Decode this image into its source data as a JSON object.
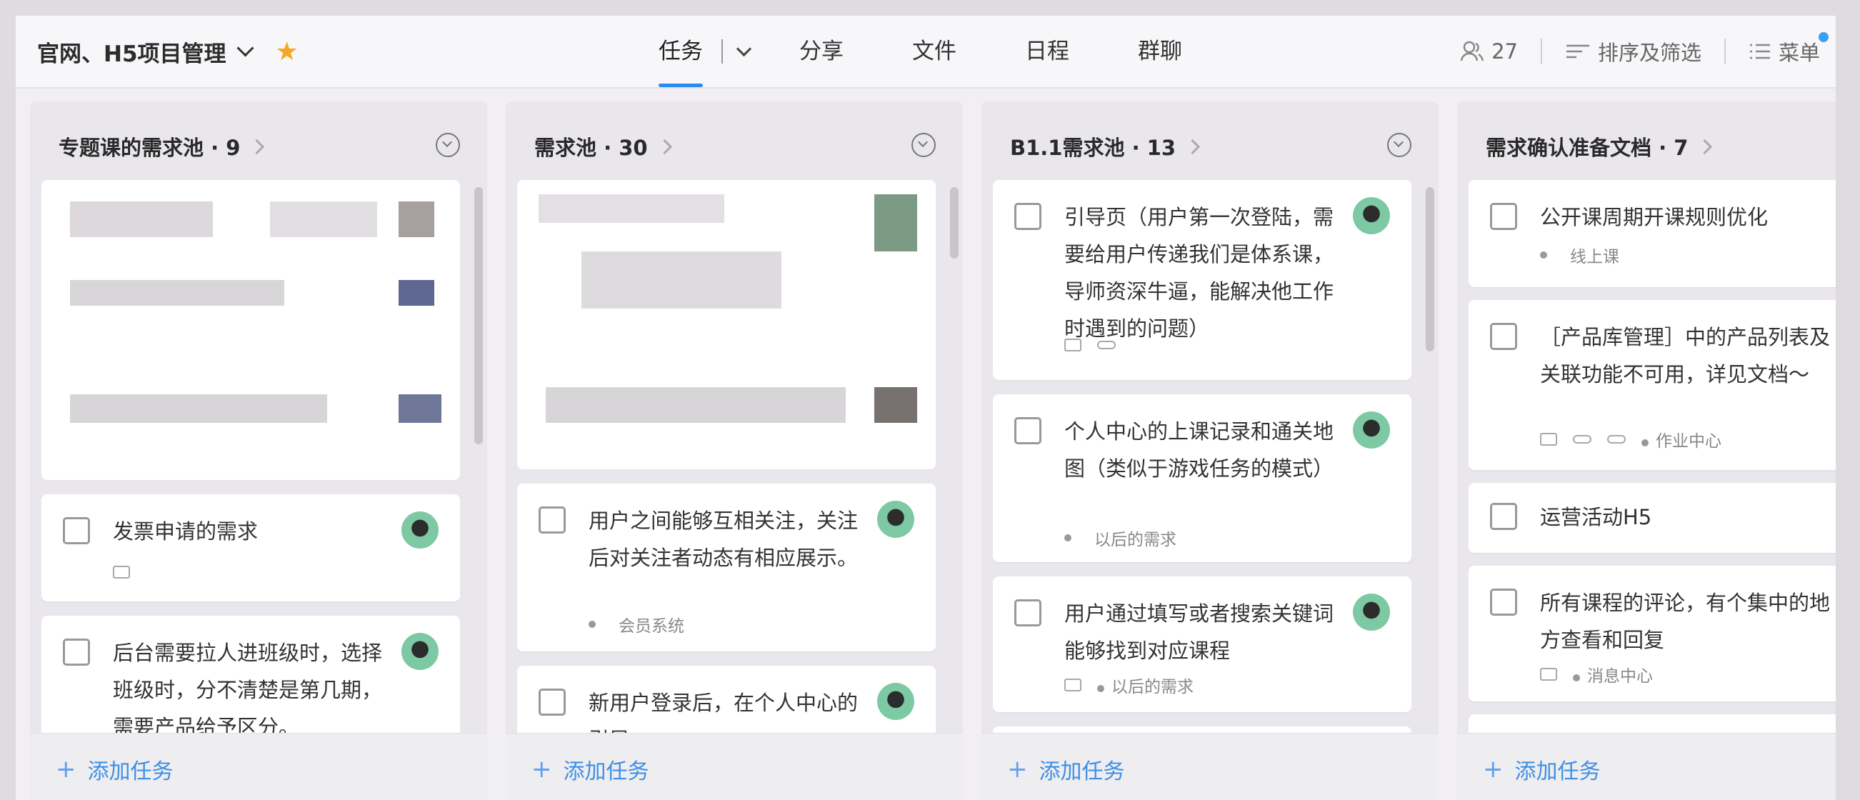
{
  "header": {
    "project_title": "官网、H5项目管理",
    "tabs": [
      "任务",
      "分享",
      "文件",
      "日程",
      "群聊"
    ],
    "members_count": "27",
    "sort_filter_label": "排序及筛选",
    "menu_label": "菜单",
    "accent_color": "#2a8cf0"
  },
  "columns": [
    {
      "title": "专题课的需求池 · 9",
      "add_task_label": "添加任务",
      "cards": [
        {
          "title": "发票申请的需求",
          "tags": []
        },
        {
          "title": "后台需要拉人进班级时，选择班级时，分不清楚是第几期，需要产品给予区分。",
          "tags": []
        }
      ]
    },
    {
      "title": "需求池 · 30",
      "add_task_label": "添加任务",
      "cards": [
        {
          "title": "用户之间能够互相关注，关注后对关注者动态有相应展示。",
          "tags": [
            "会员系统"
          ]
        },
        {
          "title": "新用户登录后，在个人中心的引导",
          "tags": []
        }
      ]
    },
    {
      "title": "B1.1需求池 · 13",
      "add_task_label": "添加任务",
      "cards": [
        {
          "title": "引导页（用户第一次登陆，需要给用户传递我们是体系课，导师资深牛逼，能解决他工作时遇到的问题）",
          "tags": []
        },
        {
          "title": "个人中心的上课记录和通关地图（类似于游戏任务的模式）",
          "tags": [
            "以后的需求"
          ]
        },
        {
          "title": "用户通过填写或者搜索关键词能够找到对应课程",
          "tags": [
            "以后的需求"
          ]
        }
      ]
    },
    {
      "title": "需求确认准备文档 · 7",
      "add_task_label": "添加任务",
      "cards": [
        {
          "title": "公开课周期开课规则优化",
          "tags": [
            "线上课"
          ]
        },
        {
          "title": "［产品库管理］中的产品列表及关联功能不可用，详见文档～",
          "tags": [
            "作业中心"
          ]
        },
        {
          "title": "运营活动H5",
          "tags": []
        },
        {
          "title": "所有课程的评论，有个集中的地方查看和回复",
          "tags": [
            "消息中心"
          ]
        }
      ]
    }
  ]
}
